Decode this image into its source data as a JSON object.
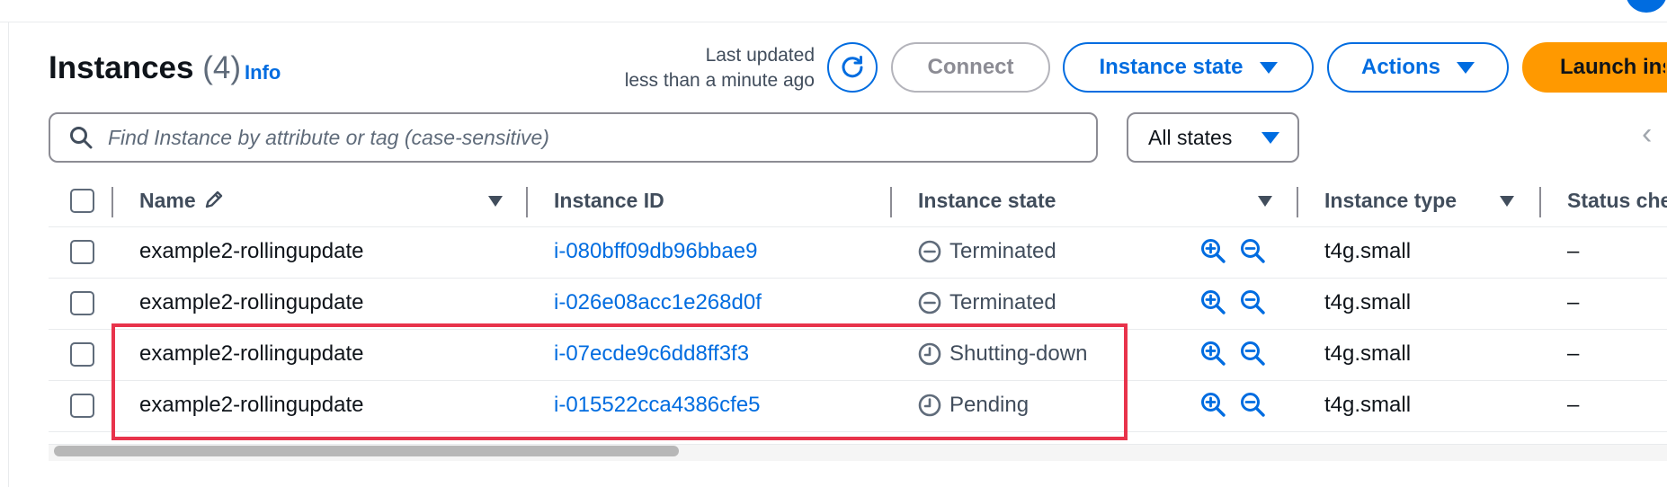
{
  "header": {
    "title": "Instances",
    "count": "(4)",
    "info_link": "Info",
    "last_updated_line1": "Last updated",
    "last_updated_line2": "less than a minute ago",
    "refresh_icon": "refresh-icon"
  },
  "toolbar": {
    "connect_label": "Connect",
    "instance_state_label": "Instance state",
    "actions_label": "Actions",
    "launch_label": "Launch ins"
  },
  "filters": {
    "search_placeholder": "Find Instance by attribute or tag (case-sensitive)",
    "states_value": "All states"
  },
  "table": {
    "columns": [
      "Name",
      "Instance ID",
      "Instance state",
      "Instance type",
      "Status che"
    ],
    "rows": [
      {
        "name": "example2-rollingupdate",
        "instance_id": "i-080bff09db96bbae9",
        "state": "Terminated",
        "state_icon": "minus-circle-icon",
        "type": "t4g.small",
        "status": "–"
      },
      {
        "name": "example2-rollingupdate",
        "instance_id": "i-026e08acc1e268d0f",
        "state": "Terminated",
        "state_icon": "minus-circle-icon",
        "type": "t4g.small",
        "status": "–"
      },
      {
        "name": "example2-rollingupdate",
        "instance_id": "i-07ecde9c6dd8ff3f3",
        "state": "Shutting-down",
        "state_icon": "clock-icon",
        "type": "t4g.small",
        "status": "–"
      },
      {
        "name": "example2-rollingupdate",
        "instance_id": "i-015522cca4386cfe5",
        "state": "Pending",
        "state_icon": "clock-icon",
        "type": "t4g.small",
        "status": "–"
      }
    ]
  },
  "colors": {
    "link_blue": "#006ce0",
    "primary_orange": "#ff9900",
    "highlight_red": "#e8334b"
  }
}
